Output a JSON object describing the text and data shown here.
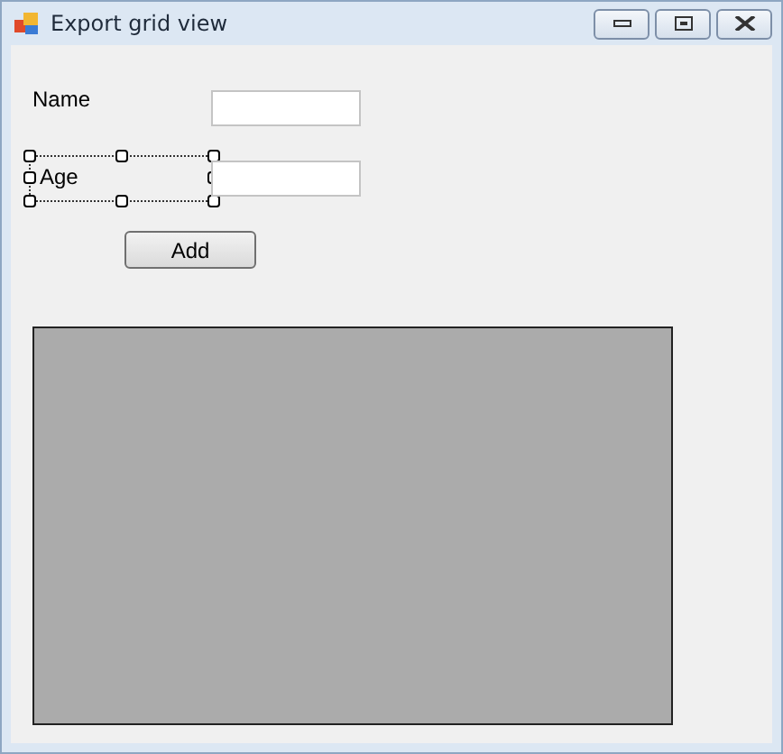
{
  "window": {
    "title": "Export grid view"
  },
  "labels": [
    {
      "text": "Name",
      "selected": false
    },
    {
      "text": "Age",
      "selected": true
    }
  ],
  "button": {
    "label": "Add"
  }
}
